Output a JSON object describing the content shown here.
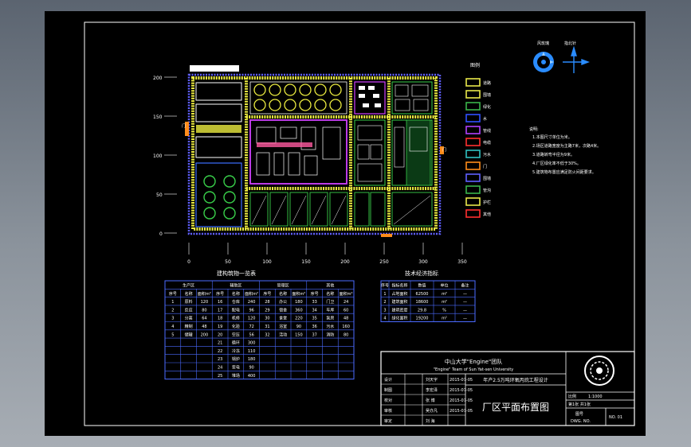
{
  "drawing": {
    "scale_labels": {
      "y": [
        "200",
        "150",
        "100",
        "50",
        "0"
      ],
      "x": [
        "0",
        "50",
        "100",
        "150",
        "200",
        "250",
        "300",
        "350"
      ]
    },
    "compass": {
      "left_label": "风玫瑰",
      "right_label": "指北针"
    },
    "legend": {
      "title": "图例",
      "items": [
        {
          "label": "道路",
          "color": "#e8e84a"
        },
        {
          "label": "围墙",
          "color": "#e8e84a"
        },
        {
          "label": "绿化",
          "color": "#39b54a"
        },
        {
          "label": "水",
          "color": "#3050ff"
        },
        {
          "label": "管线",
          "color": "#b040ff"
        },
        {
          "label": "电缆",
          "color": "#ff3030"
        },
        {
          "label": "污水",
          "color": "#30c0c0"
        },
        {
          "label": "门",
          "color": "#ff8c1a"
        },
        {
          "label": "围墙",
          "color": "#6060ff"
        },
        {
          "label": "管沟",
          "color": "#39b54a"
        },
        {
          "label": "护栏",
          "color": "#e8e84a"
        },
        {
          "label": "其他",
          "color": "#ff3030"
        }
      ]
    },
    "notes": {
      "title": "说明:",
      "lines": [
        "1.本图尺寸单位为米。",
        "2.场区道路宽度为主路7米，次路4米。",
        "3.道路转弯半径为9米。",
        "4.厂区绿化率不低于30%。",
        "5.建筑物布置应满足防火间距要求。"
      ]
    },
    "building_table": {
      "title": "建构筑物一览表",
      "groups": [
        "生产区",
        "辅助区",
        "管理区",
        "其他"
      ],
      "sub_headers": [
        "序号",
        "名称",
        "面积m²"
      ],
      "rows": [
        [
          "1",
          "原料",
          "120",
          "16",
          "仓库",
          "240",
          "28",
          "办公",
          "180",
          "33",
          "门卫",
          "24"
        ],
        [
          "2",
          "反应",
          "80",
          "17",
          "配电",
          "96",
          "29",
          "宿舍",
          "360",
          "34",
          "车库",
          "60"
        ],
        [
          "3",
          "分离",
          "64",
          "18",
          "机修",
          "120",
          "30",
          "食堂",
          "220",
          "35",
          "泵房",
          "48"
        ],
        [
          "4",
          "精制",
          "48",
          "19",
          "化验",
          "72",
          "31",
          "浴室",
          "90",
          "36",
          "污水",
          "160"
        ],
        [
          "5",
          "储罐",
          "200",
          "20",
          "空压",
          "56",
          "32",
          "活动",
          "150",
          "37",
          "消防",
          "80"
        ],
        [
          "",
          "",
          "",
          "21",
          "循环",
          "300",
          "",
          "",
          "",
          "",
          "",
          ""
        ],
        [
          "",
          "",
          "",
          "22",
          "冷冻",
          "110",
          "",
          "",
          "",
          "",
          "",
          ""
        ],
        [
          "",
          "",
          "",
          "23",
          "锅炉",
          "180",
          "",
          "",
          "",
          "",
          "",
          ""
        ],
        [
          "",
          "",
          "",
          "24",
          "变电",
          "90",
          "",
          "",
          "",
          "",
          "",
          ""
        ],
        [
          "",
          "",
          "",
          "25",
          "堆场",
          "400",
          "",
          "",
          "",
          "",
          "",
          ""
        ]
      ]
    },
    "tech_table": {
      "title": "技术经济指标",
      "headers": [
        "序号",
        "指标名称",
        "数值",
        "单位",
        "备注"
      ],
      "rows": [
        [
          "1",
          "占地面积",
          "62500",
          "m²",
          "—"
        ],
        [
          "2",
          "建筑面积",
          "18600",
          "m²",
          "—"
        ],
        [
          "3",
          "建筑密度",
          "29.8",
          "%",
          "—"
        ],
        [
          "4",
          "绿化面积",
          "19200",
          "m²",
          "—"
        ]
      ]
    },
    "title_block": {
      "org": "中山大学\"Engine\"团队",
      "org_en": "\"Engine\" Team of Sun Yat-sen University",
      "project": "年产2.5万吨环氧丙烷工程设计",
      "drawing_title": "厂区平面布置图",
      "roles": [
        {
          "role": "设计",
          "name": "刘天宇",
          "date": "2015-07-05"
        },
        {
          "role": "制图",
          "name": "李宏泽",
          "date": "2015-07-05"
        },
        {
          "role": "校对",
          "name": "张 博",
          "date": "2015-07-05"
        },
        {
          "role": "审核",
          "name": "吴亦凡",
          "date": "2015-07-05"
        },
        {
          "role": "审定",
          "name": "刘 海",
          "date": ""
        }
      ],
      "scale_label": "比例",
      "scale_value": "1:1000",
      "sheet_label": "第1张 共1张",
      "drawing_no_label": "图号",
      "drawing_no_en": "DWG. NO.",
      "sheet_no": "NO. 01"
    }
  }
}
